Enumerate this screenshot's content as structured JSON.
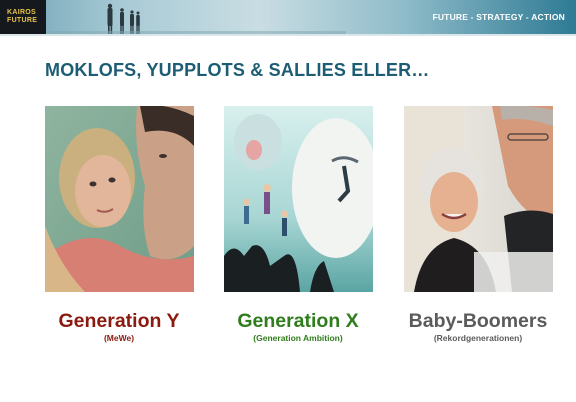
{
  "header": {
    "logo_line1": "KAIROS",
    "logo_line2": "FUTURE",
    "tagline": "FUTURE - STRATEGY - ACTION"
  },
  "title": "MOKLOFS, YUPPLOTS & SALLIES ELLER…",
  "generations": [
    {
      "name": "Generation Y",
      "subtitle": "(MeWe)",
      "color": "#8b1a10"
    },
    {
      "name": "Generation X",
      "subtitle": "(Generation Ambition)",
      "color": "#2f7d1c"
    },
    {
      "name": "Baby-Boomers",
      "subtitle": "(Rekordgenerationen)",
      "color": "#5b5b5b"
    }
  ],
  "colors": {
    "title": "#1d5d74",
    "logo_bg": "#15181c",
    "logo_text": "#e8c24a"
  }
}
